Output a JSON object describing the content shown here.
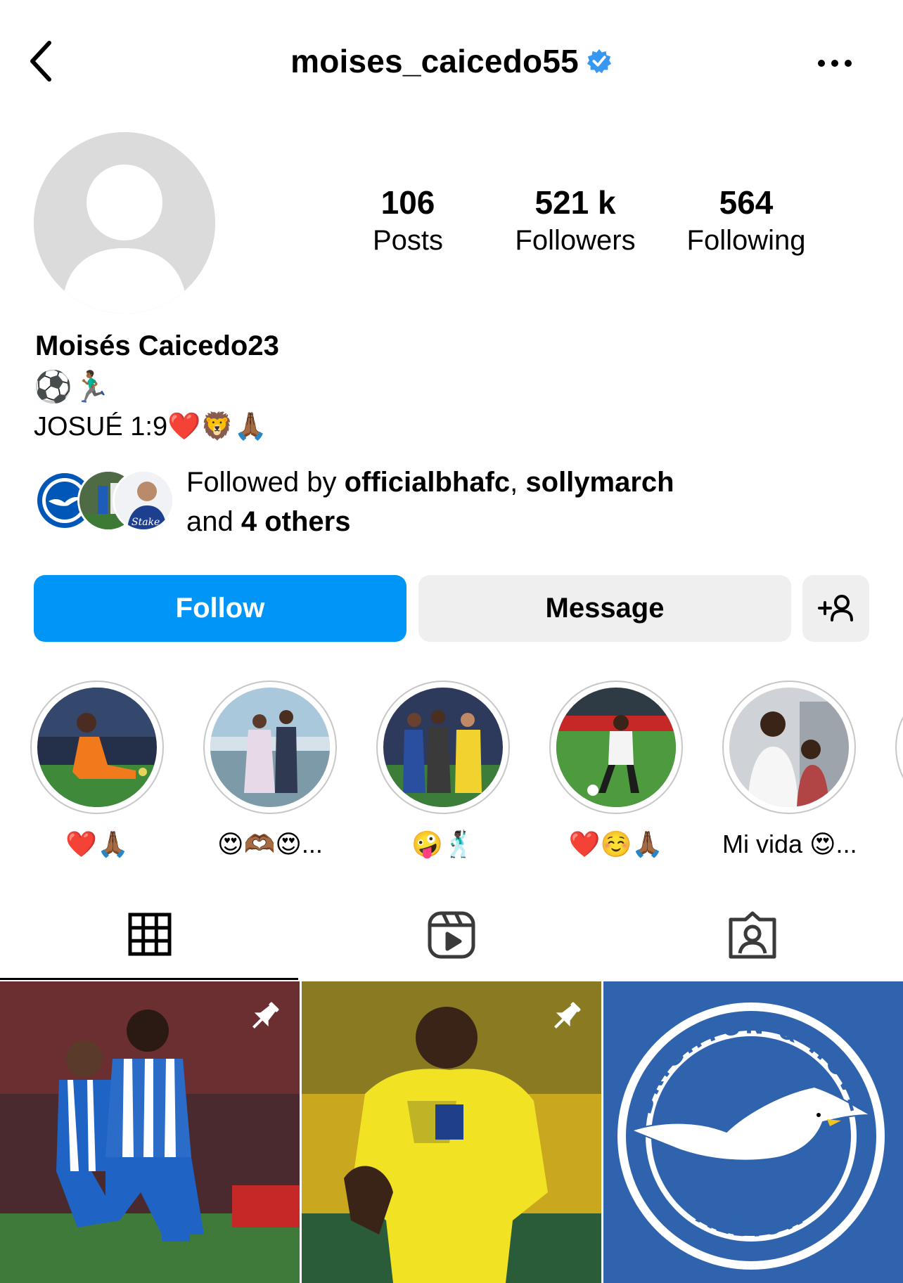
{
  "header": {
    "username": "moises_caicedo55",
    "back_icon": "chevron-left-icon",
    "verified_icon": "verified-badge-icon",
    "more_icon": "more-horizontal-icon"
  },
  "stats": {
    "posts_count": "106",
    "posts_label": "Posts",
    "followers_count": "521 k",
    "followers_label": "Followers",
    "following_count": "564",
    "following_label": "Following"
  },
  "bio": {
    "name": "Moisés Caicedo23",
    "line1": "⚽🏃🏾‍♂️",
    "line2": "JOSUÉ 1:9❤️🦁🙏🏾"
  },
  "followed_by": {
    "prefix": "Followed by ",
    "user1": "officialbhafc",
    "sep": ", ",
    "user2": "sollymarch",
    "and": "and ",
    "others": "4 others"
  },
  "actions": {
    "follow_label": "Follow",
    "message_label": "Message",
    "add_user_icon": "add-user-icon"
  },
  "highlights": [
    {
      "label": "❤️🙏🏾"
    },
    {
      "label": "😍🫶🏾😍..."
    },
    {
      "label": "🤪🕺🏿"
    },
    {
      "label": "❤️☺️🙏🏾"
    },
    {
      "label": "Mi vida 😍..."
    }
  ],
  "tabs": {
    "grid_icon": "grid-icon",
    "reels_icon": "reels-icon",
    "tagged_icon": "tagged-user-icon"
  },
  "posts": {
    "pin_icon": "pin-icon",
    "crest_top": "BRIGHTON & HOVE",
    "crest_bottom": "ALBION"
  },
  "colors": {
    "accent": "#0095f6",
    "verified": "#3897f0",
    "secondary_button": "#efefef",
    "brighton_blue": "#0057b8"
  }
}
